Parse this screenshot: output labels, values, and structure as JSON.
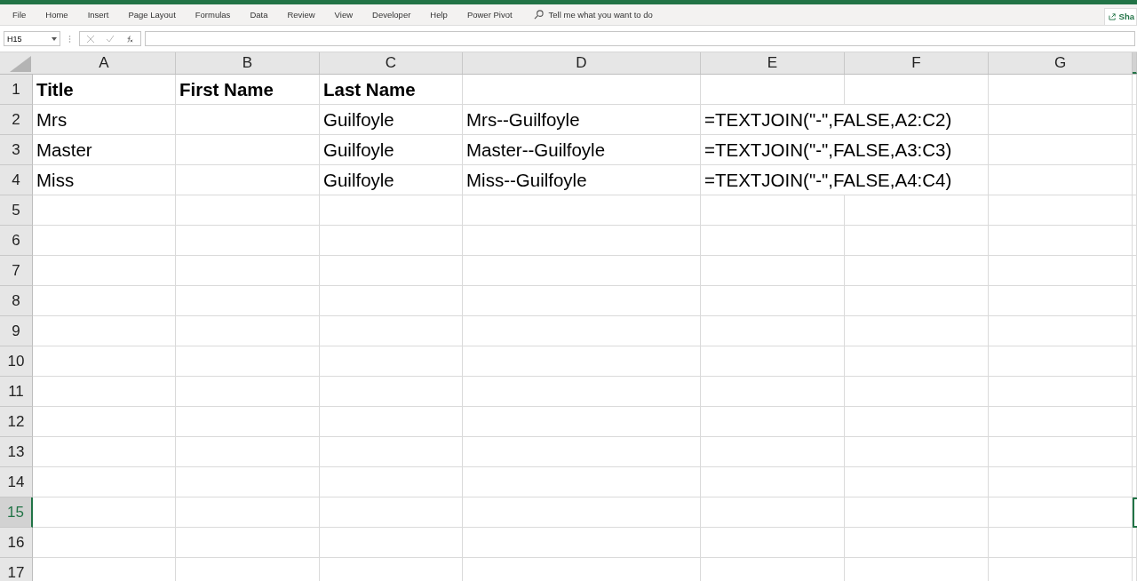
{
  "ribbon_tabs": [
    {
      "label": "File"
    },
    {
      "label": "Home"
    },
    {
      "label": "Insert"
    },
    {
      "label": "Page Layout"
    },
    {
      "label": "Formulas"
    },
    {
      "label": "Data"
    },
    {
      "label": "Review"
    },
    {
      "label": "View"
    },
    {
      "label": "Developer"
    },
    {
      "label": "Help"
    },
    {
      "label": "Power Pivot"
    }
  ],
  "tell_me": {
    "placeholder": "Tell me what you want to do"
  },
  "share_button": {
    "label": "Sha"
  },
  "formula_bar": {
    "name_box": "H15"
  },
  "columns": [
    {
      "label": "A",
      "selected": false
    },
    {
      "label": "B",
      "selected": false
    },
    {
      "label": "C",
      "selected": false
    },
    {
      "label": "D",
      "selected": false
    },
    {
      "label": "E",
      "selected": false
    },
    {
      "label": "F",
      "selected": false
    },
    {
      "label": "G",
      "selected": false
    },
    {
      "selected": true
    }
  ],
  "rows": [
    {
      "header": "1",
      "selected": false,
      "bold": true,
      "cells": {
        "a": "Title",
        "b": "First Name",
        "c": "Last Name"
      }
    },
    {
      "header": "2",
      "selected": false,
      "bold": false,
      "cells": {
        "a": "Mrs",
        "c": "Guilfoyle",
        "d": "Mrs--Guilfoyle",
        "e": "=TEXTJOIN(\"-\",FALSE,A2:C2)"
      }
    },
    {
      "header": "3",
      "selected": false,
      "bold": false,
      "cells": {
        "a": "Master",
        "c": "Guilfoyle",
        "d": "Master--Guilfoyle",
        "e": "=TEXTJOIN(\"-\",FALSE,A3:C3)"
      }
    },
    {
      "header": "4",
      "selected": false,
      "bold": false,
      "cells": {
        "a": "Miss",
        "c": "Guilfoyle",
        "d": "Miss--Guilfoyle",
        "e": "=TEXTJOIN(\"-\",FALSE,A4:C4)"
      }
    },
    {
      "header": "5",
      "selected": false
    },
    {
      "header": "6",
      "selected": false
    },
    {
      "header": "7",
      "selected": false
    },
    {
      "header": "8",
      "selected": false
    },
    {
      "header": "9",
      "selected": false
    },
    {
      "header": "10",
      "selected": false
    },
    {
      "header": "11",
      "selected": false
    },
    {
      "header": "12",
      "selected": false
    },
    {
      "header": "13",
      "selected": false
    },
    {
      "header": "14",
      "selected": false
    },
    {
      "header": "15",
      "selected": true
    },
    {
      "header": "16",
      "selected": false
    },
    {
      "header": "17",
      "selected": false
    }
  ]
}
